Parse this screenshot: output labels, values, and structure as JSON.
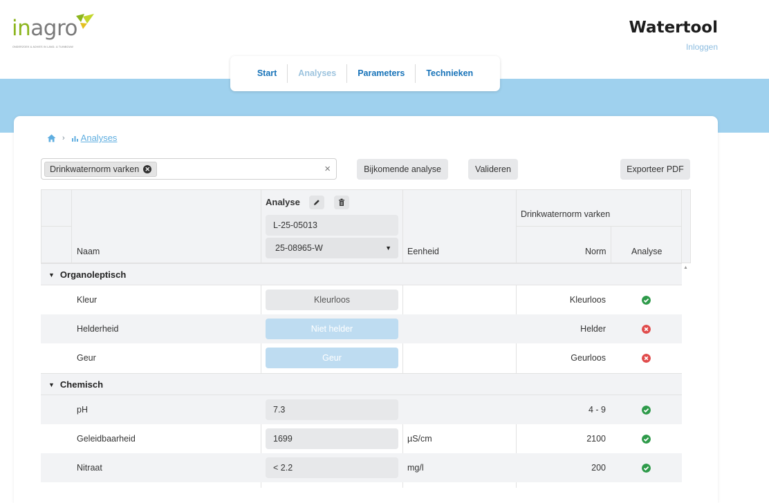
{
  "brand": {
    "logo_text_part1": "in",
    "logo_text_part2": "agro",
    "logo_tagline": "ONDERZOEK & ADVIES IN LAND- & TUINBOUW",
    "app_title": "Watertool",
    "login": "Inloggen"
  },
  "nav": [
    {
      "label": "Start",
      "active": false
    },
    {
      "label": "Analyses",
      "active": true
    },
    {
      "label": "Parameters",
      "active": false
    },
    {
      "label": "Technieken",
      "active": false
    }
  ],
  "breadcrumb": {
    "current": "Analyses"
  },
  "filter": {
    "chip_label": "Drinkwaternorm varken"
  },
  "toolbar": {
    "add_analysis": "Bijkomende analyse",
    "validate": "Valideren",
    "export_pdf": "Exporteer PDF"
  },
  "table": {
    "header": {
      "analyse": "Analyse",
      "analysis_code": "L-25-05013",
      "sample_selected": "25-08965-W",
      "name": "Naam",
      "unit": "Eenheid",
      "norm_group": "Drinkwaternorm varken",
      "norm": "Norm",
      "analysis_result": "Analyse"
    },
    "groups": [
      {
        "label": "Organoleptisch",
        "rows": [
          {
            "name": "Kleur",
            "value": "Kleurloos",
            "unit": "",
            "norm": "Kleurloos",
            "ok": true
          },
          {
            "name": "Helderheid",
            "value": "Niet helder",
            "unit": "",
            "norm": "Helder",
            "ok": false
          },
          {
            "name": "Geur",
            "value": "Geur",
            "unit": "",
            "norm": "Geurloos",
            "ok": false
          }
        ]
      },
      {
        "label": "Chemisch",
        "rows": [
          {
            "name": "pH",
            "value": "7.3",
            "unit": "",
            "norm": "4 - 9",
            "ok": true
          },
          {
            "name": "Geleidbaarheid",
            "value": "1699",
            "unit": "µS/cm",
            "norm": "2100",
            "ok": true
          },
          {
            "name": "Nitraat",
            "value": "< 2.2",
            "unit": "mg/l",
            "norm": "200",
            "ok": true
          }
        ]
      }
    ]
  },
  "colors": {
    "brand_green": "#8cb51e",
    "nav_blue": "#1672b8",
    "banner": "#9fd1ee",
    "ok": "#2e9a4a",
    "bad": "#e04b4b"
  }
}
